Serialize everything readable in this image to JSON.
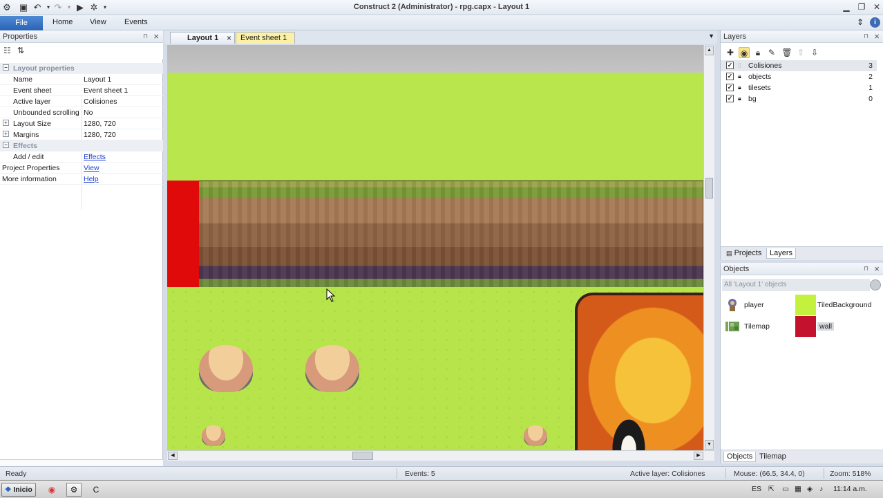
{
  "window": {
    "title": "Construct 2 (Administrator) - rpg.capx - Layout 1"
  },
  "ribbon": {
    "file": "File",
    "tabs": [
      "Home",
      "View",
      "Events"
    ]
  },
  "properties": {
    "title": "Properties",
    "rows": [
      {
        "key": "Layout properties",
        "value": "",
        "type": "category"
      },
      {
        "key": "Name",
        "value": "Layout 1"
      },
      {
        "key": "Event sheet",
        "value": "Event sheet 1"
      },
      {
        "key": "Active layer",
        "value": "Colisiones"
      },
      {
        "key": "Unbounded scrolling",
        "value": "No"
      },
      {
        "key": "Layout Size",
        "value": "1280, 720"
      },
      {
        "key": "Margins",
        "value": "1280, 720"
      },
      {
        "key": "Effects",
        "value": "",
        "type": "category"
      },
      {
        "key": "Add / edit",
        "value": "Effects",
        "link": true
      },
      {
        "key": "Project Properties",
        "value": "View",
        "link": true
      },
      {
        "key": "More information",
        "value": "Help",
        "link": true
      }
    ]
  },
  "document": {
    "tabs": [
      {
        "label": "Layout 1",
        "active": true
      },
      {
        "label": "Event sheet 1",
        "active": false
      }
    ]
  },
  "layers": {
    "title": "Layers",
    "items": [
      {
        "name": "Colisiones",
        "number": "3",
        "checked": true,
        "locked": false,
        "selected": true
      },
      {
        "name": "objects",
        "number": "2",
        "checked": true,
        "locked": true
      },
      {
        "name": "tilesets",
        "number": "1",
        "checked": true,
        "locked": true
      },
      {
        "name": "bg",
        "number": "0",
        "checked": true,
        "locked": true
      }
    ],
    "panel_tabs": [
      "Projects",
      "Layers"
    ]
  },
  "objects": {
    "title": "Objects",
    "filter": "All 'Layout 1' objects",
    "items": [
      {
        "name": "player",
        "icon": "player-sprite-icon"
      },
      {
        "name": "TiledBackground",
        "color": "#c3f13d"
      },
      {
        "name": "Tilemap",
        "icon": "tilemap-icon"
      },
      {
        "name": "wall",
        "color": "#c4112e"
      }
    ],
    "panel_tabs": [
      "Objects",
      "Tilemap"
    ]
  },
  "status": {
    "ready": "Ready",
    "events": "Events: 5",
    "active_layer": "Active layer: Colisiones",
    "mouse": "Mouse: (66.5, 34.4, 0)",
    "zoom": "Zoom: 518%"
  },
  "taskbar": {
    "start": "Inicio",
    "lang": "ES",
    "time": "11:14 a.m."
  },
  "colors": {
    "file_tab": "#2a63b5",
    "event_tab": "#fbf1a6",
    "grass": "#b9e64c",
    "wall": "#e00a0a"
  }
}
